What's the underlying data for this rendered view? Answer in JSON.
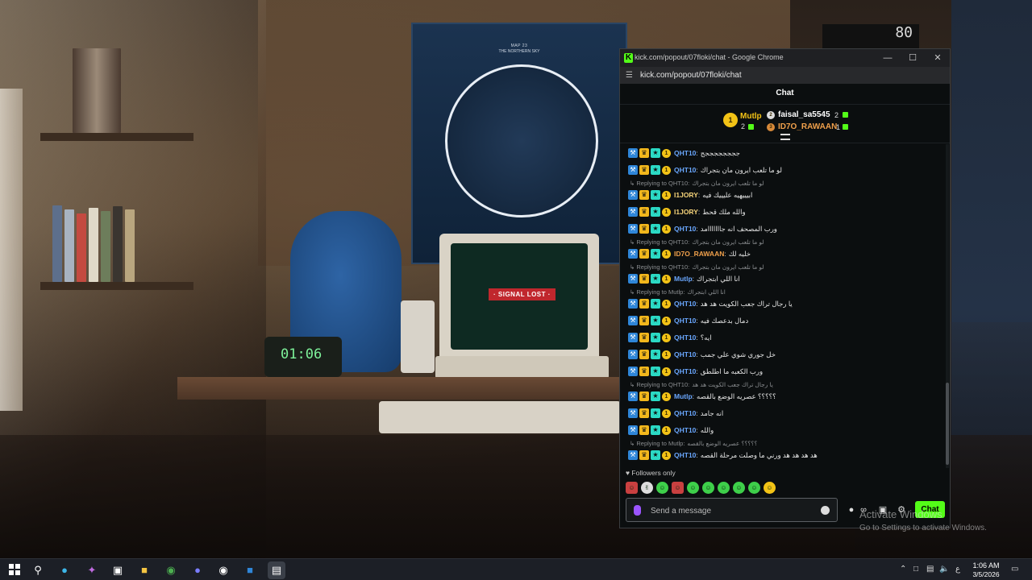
{
  "wallpaper": {
    "poster_title": "MAP 23",
    "poster_subtitle": "THE NORTHERN SKY",
    "monitor_banner": "· SIGNAL LOST ·",
    "desk_clock": "01:06",
    "scoreboard": "80"
  },
  "window": {
    "title": "kick.com/popout/07floki/chat - Google Chrome",
    "url": "kick.com/popout/07floki/chat",
    "controls": [
      "minimize",
      "maximize",
      "close"
    ],
    "colors": {
      "accent": "#53fc18",
      "bg": "#0b0e0f"
    }
  },
  "chat": {
    "header": "Chat",
    "leaderboard": [
      {
        "rank": "1",
        "name": "Mutlp",
        "count": "2",
        "color": "#f3c316"
      },
      {
        "rank": "2",
        "name": "faisal_sa5545",
        "count": "2",
        "color": "#ffffff"
      },
      {
        "rank": "3",
        "name": "ID7O_RAWAAN",
        "count": "1",
        "color": "#f0a04b"
      }
    ],
    "messages": [
      {
        "user": "QHT10",
        "text": "ججججججججج",
        "color": "#6aa7ff"
      },
      {
        "user": "QHT10",
        "text": "لو ما تلعب ايرون مان بتجراك",
        "color": "#6aa7ff"
      },
      {
        "reply_to": "Replying to QHT10:",
        "reply_text": "لو ما تلعب ايرون مان بتجراك",
        "user": "I1JORY",
        "text": "ابيييهيه عليييك فيه",
        "color": "#f5d37a"
      },
      {
        "user": "I1JORY",
        "text": "والله ملك قحط",
        "color": "#f5d37a"
      },
      {
        "user": "QHT10",
        "text": "ورب المصحف انه جااااااامد",
        "color": "#6aa7ff"
      },
      {
        "reply_to": "Replying to QHT10:",
        "reply_text": "لو ما تلعب ايرون مان بتجراك",
        "user": "ID7O_RAWAAN",
        "text": "خليه لك",
        "color": "#f0a04b"
      },
      {
        "reply_to": "Replying to QHT10:",
        "reply_text": "لو ما تلعب ايرون مان بتجراك",
        "user": "Mutlp",
        "text": "انا اللي ابتجراك",
        "color": "#6aa7ff"
      },
      {
        "reply_to": "Replying to Mutlp:",
        "reply_text": "انا اللي ابتجراك",
        "user": "QHT10",
        "text": "يا رجال تراك جعب الكويت هد هد",
        "color": "#6aa7ff"
      },
      {
        "user": "QHT10",
        "text": "دمال بدعصك فيه",
        "color": "#6aa7ff"
      },
      {
        "user": "QHT10",
        "text": "ايه؟",
        "color": "#6aa7ff"
      },
      {
        "user": "QHT10",
        "text": "خل جوري شوي علي جمب",
        "color": "#6aa7ff"
      },
      {
        "user": "QHT10",
        "text": "ورب الكعبه ما اطلطق",
        "color": "#6aa7ff"
      },
      {
        "reply_to": "Replying to QHT10:",
        "reply_text": "يا رجال تراك جعب الكويت هد هد",
        "user": "Mutlp",
        "text": "؟؟؟؟؟ عصريه الوضع بالقصه",
        "color": "#6aa7ff"
      },
      {
        "user": "QHT10",
        "text": "انه جامد",
        "color": "#6aa7ff"
      },
      {
        "user": "QHT10",
        "text": "والله",
        "color": "#6aa7ff"
      },
      {
        "reply_to": "Replying to Mutlp:",
        "reply_text": "؟؟؟؟؟ عصريه الوضع بالقصه",
        "user": "QHT10",
        "text": "هد هد هد هد ورني ما وصلت مرحلة القصه",
        "color": "#6aa7ff"
      }
    ],
    "followers_only": "Followers only",
    "composer": {
      "placeholder": "Send a message",
      "send_label": "Chat"
    }
  },
  "activation": {
    "line1": "Activate Windows",
    "line2": "Go to Settings to activate Windows."
  },
  "taskbar": {
    "time": "1:06 AM",
    "date": "3/5/2026",
    "language": "ع"
  }
}
